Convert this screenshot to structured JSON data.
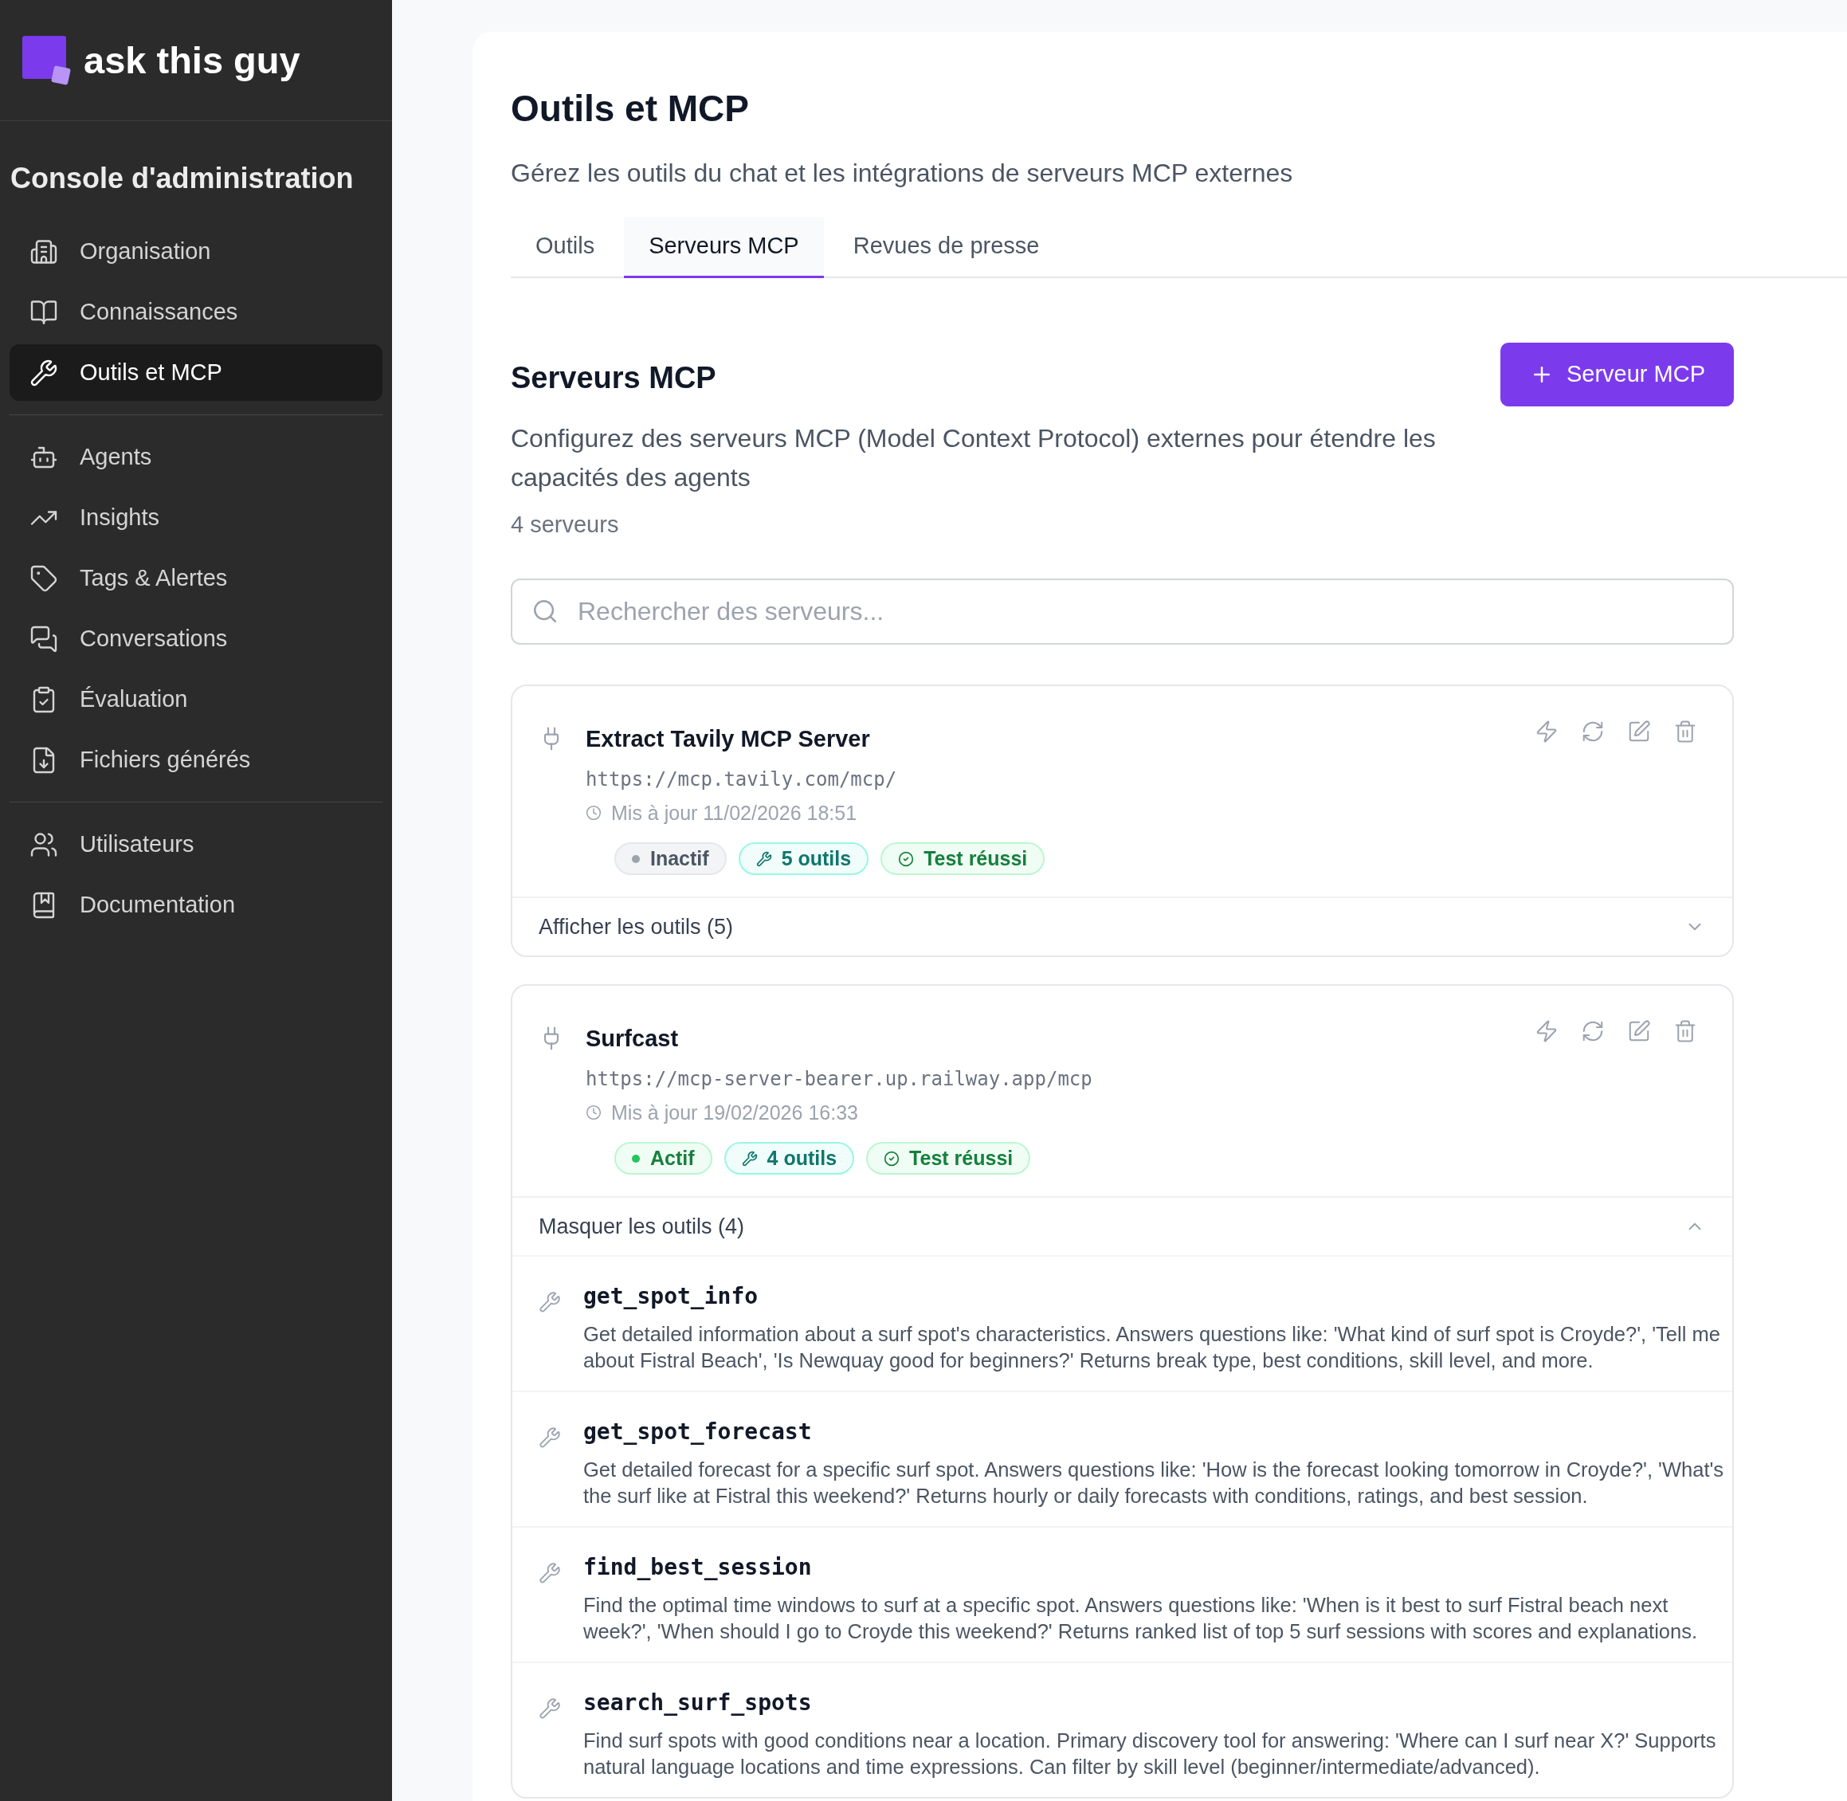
{
  "sidebar": {
    "brand": "ask this guy",
    "title": "Console d'administration",
    "groups": [
      {
        "items": [
          {
            "label": "Organisation",
            "selected": false
          },
          {
            "label": "Connaissances",
            "selected": false
          },
          {
            "label": "Outils et MCP",
            "selected": true
          }
        ]
      },
      {
        "items": [
          {
            "label": "Agents",
            "selected": false
          },
          {
            "label": "Insights",
            "selected": false
          },
          {
            "label": "Tags & Alertes",
            "selected": false
          },
          {
            "label": "Conversations",
            "selected": false
          },
          {
            "label": "Évaluation",
            "selected": false
          },
          {
            "label": "Fichiers générés",
            "selected": false
          }
        ]
      },
      {
        "items": [
          {
            "label": "Utilisateurs",
            "selected": false
          },
          {
            "label": "Documentation",
            "selected": false
          }
        ]
      }
    ]
  },
  "page": {
    "title": "Outils et MCP",
    "subtitle": "Gérez les outils du chat et les intégrations de serveurs MCP externes"
  },
  "tabs": [
    {
      "label": "Outils",
      "selected": false
    },
    {
      "label": "Serveurs MCP",
      "selected": true
    },
    {
      "label": "Revues de presse",
      "selected": false
    }
  ],
  "section": {
    "title": "Serveurs MCP",
    "description": "Configurez des serveurs MCP (Model Context Protocol) externes pour étendre les capacités des agents",
    "count": "4 serveurs",
    "add_button": "Serveur MCP"
  },
  "search": {
    "placeholder": "Rechercher des serveurs..."
  },
  "servers": [
    {
      "name": "Extract Tavily MCP Server",
      "url": "https://mcp.tavily.com/mcp/",
      "updated": "Mis à jour 11/02/2026 18:51",
      "status": {
        "label": "Inactif",
        "active": false
      },
      "tools_badge": "5 outils",
      "test_badge": "Test réussi",
      "toggle": "Afficher les outils (5)",
      "expanded": false
    },
    {
      "name": "Surfcast",
      "url": "https://mcp-server-bearer.up.railway.app/mcp",
      "updated": "Mis à jour 19/02/2026 16:33",
      "status": {
        "label": "Actif",
        "active": true
      },
      "tools_badge": "4 outils",
      "test_badge": "Test réussi",
      "toggle": "Masquer les outils (4)",
      "expanded": true,
      "tools": [
        {
          "name": "get_spot_info",
          "description": "Get detailed information about a surf spot's characteristics. Answers questions like: 'What kind of surf spot is Croyde?', 'Tell me about Fistral Beach', 'Is Newquay good for beginners?' Returns break type, best conditions, skill level, and more."
        },
        {
          "name": "get_spot_forecast",
          "description": "Get detailed forecast for a specific surf spot. Answers questions like: 'How is the forecast looking tomorrow in Croyde?', 'What's the surf like at Fistral this weekend?' Returns hourly or daily forecasts with conditions, ratings, and best session."
        },
        {
          "name": "find_best_session",
          "description": "Find the optimal time windows to surf at a specific spot. Answers questions like: 'When is it best to surf Fistral beach next week?', 'When should I go to Croyde this weekend?' Returns ranked list of top 5 surf sessions with scores and explanations."
        },
        {
          "name": "search_surf_spots",
          "description": "Find surf spots with good conditions near a location. Primary discovery tool for answering: 'Where can I surf near X?' Supports natural language locations and time expressions. Can filter by skill level (beginner/intermediate/advanced)."
        }
      ]
    }
  ]
}
